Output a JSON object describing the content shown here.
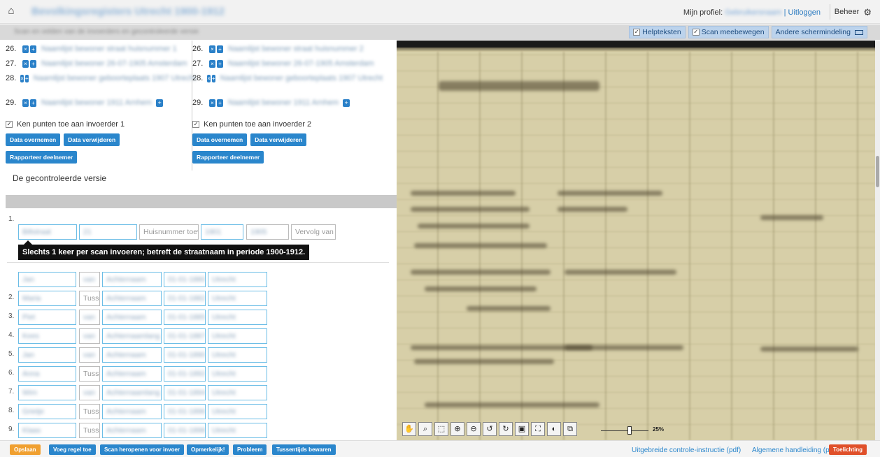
{
  "header": {
    "title": "Bevolkingsregisters Utrecht 1900-1912",
    "profile_label": "Mijn profiel:",
    "username": "Gebruikersnaam",
    "logout": "| Uitloggen",
    "admin": "Beheer"
  },
  "subbar": {
    "crumb": "Scan en velden van de invoerders en gecontroleerde versie",
    "options": {
      "help": "Helpteksten",
      "scan_follow": "Scan meebewegen",
      "layout": "Andere schermindeling"
    }
  },
  "compare": {
    "col1": {
      "entries": [
        {
          "num": "26.",
          "text": "Naamlijst bewoner straat huisnummer 1"
        },
        {
          "num": "27.",
          "text": "Naamlijst bewoner 26-07-1905 Amsterdam"
        },
        {
          "num": "28.",
          "text": "Naamlijst bewoner geboorteplaats 1907 Utrecht"
        },
        {
          "num": "29.",
          "text": "Naamlijst bewoner 1911 Arnhem"
        }
      ],
      "award": "Ken punten toe aan invoerder 1",
      "take_data": "Data overnemen",
      "delete_data": "Data verwijderen",
      "report": "Rapporteer deelnemer"
    },
    "col2": {
      "entries": [
        {
          "num": "26.",
          "text": "Naamlijst bewoner straat huisnummer 2"
        },
        {
          "num": "27.",
          "text": "Naamlijst bewoner 26-07-1905 Amsterdam"
        },
        {
          "num": "28.",
          "text": "Naamlijst bewoner geboorteplaats 1907 Utrecht"
        },
        {
          "num": "29.",
          "text": "Naamlijst bewoner 1911 Arnhem"
        }
      ],
      "award": "Ken punten toe aan invoerder 2",
      "take_data": "Data overnemen",
      "delete_data": "Data verwijderen",
      "report": "Rapporteer deelnemer"
    },
    "checked_version": "De gecontroleerde versie"
  },
  "form": {
    "address": {
      "num": "1.",
      "street": "Biltstraat",
      "number": "21",
      "house_suffix_placeholder": "Huisnummer toevoeging",
      "from": "1901",
      "to": "1905",
      "continuation_placeholder": "Vervolg van blad"
    },
    "tooltip": "Slechts 1 keer per scan invoeren; betreft de straatnaam in periode 1900-1912.",
    "rows": [
      {
        "num": "",
        "first": "Jan",
        "prefix": "van",
        "last": "Achternaam",
        "date": "01-01-1880",
        "place": "Utrecht"
      },
      {
        "num": "2.",
        "first": "Maria",
        "prefix": "Tussenvoegsel",
        "last": "Achternaam",
        "date": "01-01-1882",
        "place": "Utrecht"
      },
      {
        "num": "3.",
        "first": "Piet",
        "prefix": "van",
        "last": "Achternaam",
        "date": "01-01-1885",
        "place": "Utrecht"
      },
      {
        "num": "4.",
        "first": "Kees",
        "prefix": "van",
        "last": "Achternaamlang",
        "date": "01-01-1887",
        "place": "Utrecht"
      },
      {
        "num": "5.",
        "first": "Jan",
        "prefix": "van",
        "last": "Achternaam",
        "date": "01-01-1890",
        "place": "Utrecht"
      },
      {
        "num": "6.",
        "first": "Anna",
        "prefix": "Tussenvoegsel",
        "last": "Achternaam",
        "date": "01-01-1892",
        "place": "Utrecht"
      },
      {
        "num": "7.",
        "first": "Wim",
        "prefix": "van",
        "last": "Achternaamlang",
        "date": "01-01-1894",
        "place": "Utrecht"
      },
      {
        "num": "8.",
        "first": "Grietje",
        "prefix": "Tussenvoegsel",
        "last": "Achternaam",
        "date": "01-01-1896",
        "place": "Utrecht"
      },
      {
        "num": "9.",
        "first": "Klaas",
        "prefix": "Tussenvoegsel",
        "last": "Achternaam",
        "date": "01-01-1898",
        "place": "Utrecht"
      }
    ]
  },
  "viewer": {
    "zoom": "25%"
  },
  "bottom": {
    "save": "Opslaan",
    "add_row": "Voeg regel toe",
    "reopen": "Scan heropenen voor invoer",
    "remark": "Opmerkelijk!",
    "problem": "Probleem",
    "interim_save": "Tussentijds bewaren",
    "control_instruction": "Uitgebreide controle-instructie (pdf)",
    "manual": "Algemene handleiding (pdf)",
    "explanation": "Toelichting"
  },
  "colors": {
    "accent": "#2a86cc",
    "orange": "#f0a030",
    "red": "#e0502a"
  }
}
